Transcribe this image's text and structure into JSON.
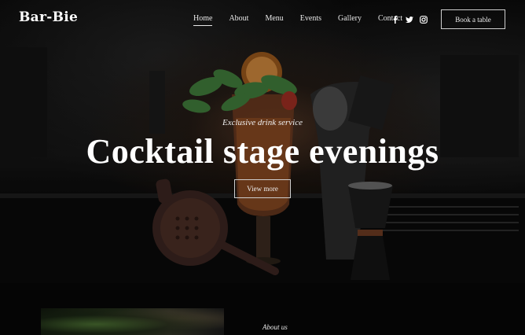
{
  "brand": {
    "logo": "Bar-Bie"
  },
  "nav": {
    "items": [
      {
        "label": "Home",
        "active": true
      },
      {
        "label": "About",
        "active": false
      },
      {
        "label": "Menu",
        "active": false
      },
      {
        "label": "Events",
        "active": false
      },
      {
        "label": "Gallery",
        "active": false
      },
      {
        "label": "Contact",
        "active": false
      }
    ],
    "socials": [
      "facebook-icon",
      "twitter-icon",
      "instagram-icon"
    ],
    "cta_label": "Book a table"
  },
  "hero": {
    "tagline": "Exclusive drink service",
    "headline": "Cocktail stage evenings",
    "button_label": "View more"
  },
  "about": {
    "label": "About us"
  },
  "colors": {
    "background": "#050505",
    "text": "#ffffff",
    "border": "#cfcfcf"
  }
}
